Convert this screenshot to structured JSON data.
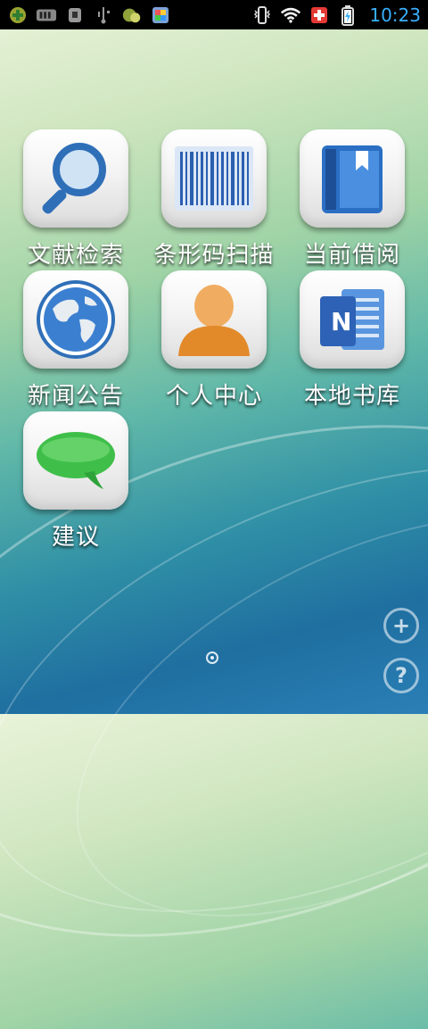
{
  "statusbar": {
    "left_icons": [
      "plus-circle-icon",
      "bars-icon",
      "android-icon",
      "usb-icon",
      "puzzle-icon",
      "photos-icon"
    ],
    "right_icons": [
      "vibrate-icon",
      "wifi-icon",
      "medical-icon",
      "battery-charging-icon"
    ],
    "time": "10:23"
  },
  "apps": [
    {
      "label": "文献检索",
      "icon": "magnifier-icon"
    },
    {
      "label": "条形码扫描",
      "icon": "barcode-icon"
    },
    {
      "label": "当前借阅",
      "icon": "book-icon"
    },
    {
      "label": "新闻公告",
      "icon": "globe-icon"
    },
    {
      "label": "个人中心",
      "icon": "person-icon"
    },
    {
      "label": "本地书库",
      "icon": "notes-icon"
    },
    {
      "label": "建议",
      "icon": "speech-bubble-icon"
    }
  ],
  "bottom": {
    "add_symbol": "+",
    "help_symbol": "?"
  }
}
